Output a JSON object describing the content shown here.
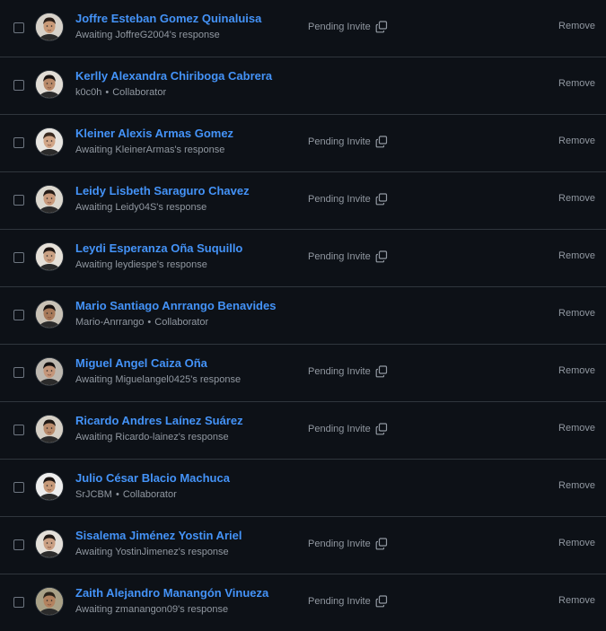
{
  "members": [
    {
      "name": "Joffre Esteban Gomez Quinaluisa",
      "subtitle": "Awaiting JoffreG2004's response",
      "login": "",
      "role": "",
      "status": "Pending Invite",
      "action": "Remove"
    },
    {
      "name": "Kerlly Alexandra Chiriboga Cabrera",
      "subtitle": "",
      "login": "k0c0h",
      "role": "Collaborator",
      "status": "",
      "action": "Remove"
    },
    {
      "name": "Kleiner Alexis Armas Gomez",
      "subtitle": "Awaiting KleinerArmas's response",
      "login": "",
      "role": "",
      "status": "Pending Invite",
      "action": "Remove"
    },
    {
      "name": "Leidy Lisbeth Saraguro Chavez",
      "subtitle": "Awaiting Leidy04S's response",
      "login": "",
      "role": "",
      "status": "Pending Invite",
      "action": "Remove"
    },
    {
      "name": "Leydi Esperanza Oña Suquillo",
      "subtitle": "Awaiting leydiespe's response",
      "login": "",
      "role": "",
      "status": "Pending Invite",
      "action": "Remove"
    },
    {
      "name": "Mario Santiago Anrrango Benavides",
      "subtitle": "",
      "login": "Mario-Anrrango",
      "role": "Collaborator",
      "status": "",
      "action": "Remove"
    },
    {
      "name": "Miguel Angel Caiza Oña",
      "subtitle": "Awaiting Miguelangel0425's response",
      "login": "",
      "role": "",
      "status": "Pending Invite",
      "action": "Remove"
    },
    {
      "name": "Ricardo Andres Laínez Suárez",
      "subtitle": "Awaiting Ricardo-lainez's response",
      "login": "",
      "role": "",
      "status": "Pending Invite",
      "action": "Remove"
    },
    {
      "name": "Julio César Blacio Machuca",
      "subtitle": "",
      "login": "SrJCBM",
      "role": "Collaborator",
      "status": "",
      "action": "Remove"
    },
    {
      "name": "Sisalema Jiménez Yostin Ariel",
      "subtitle": "Awaiting YostinJimenez's response",
      "login": "",
      "role": "",
      "status": "Pending Invite",
      "action": "Remove"
    },
    {
      "name": "Zaith Alejandro Manangón Vinueza",
      "subtitle": "Awaiting zmanangon09's response",
      "login": "",
      "role": "",
      "status": "Pending Invite",
      "action": "Remove"
    }
  ],
  "separator": "•",
  "colors": {
    "background": "#0d1117",
    "link": "#4493f8",
    "muted": "#9198a1",
    "border": "#30363d"
  },
  "icons": {
    "copy": "copy-icon",
    "avatar": "user-avatar"
  }
}
